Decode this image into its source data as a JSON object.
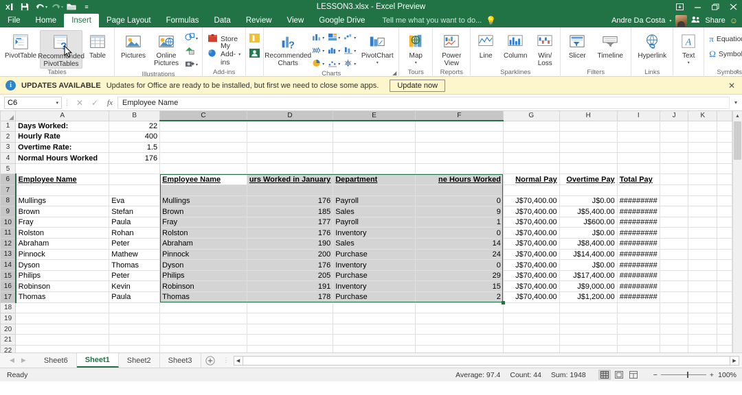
{
  "titlebar": {
    "filename": "LESSON3.xlsx - Excel Preview",
    "qat": [
      {
        "name": "excel-logo-icon",
        "label": "XL"
      },
      {
        "name": "save-icon",
        "label": "Save"
      },
      {
        "name": "undo-icon",
        "label": "Undo"
      },
      {
        "name": "redo-icon",
        "label": "Redo"
      },
      {
        "name": "open-icon",
        "label": "Open"
      },
      {
        "name": "customize-qat-icon",
        "label": "Customize Quick Access Toolbar"
      }
    ],
    "window_controls": [
      {
        "name": "ribbon-display-options-button",
        "glyph": "❐"
      },
      {
        "name": "minimize-button",
        "glyph": "—"
      },
      {
        "name": "restore-button",
        "glyph": "❐"
      },
      {
        "name": "close-button",
        "glyph": "✕"
      }
    ]
  },
  "tabs": {
    "items": [
      {
        "label": "File",
        "active": false
      },
      {
        "label": "Home",
        "active": false
      },
      {
        "label": "Insert",
        "active": true
      },
      {
        "label": "Page Layout",
        "active": false
      },
      {
        "label": "Formulas",
        "active": false
      },
      {
        "label": "Data",
        "active": false
      },
      {
        "label": "Review",
        "active": false
      },
      {
        "label": "View",
        "active": false
      },
      {
        "label": "Google Drive",
        "active": false
      }
    ],
    "tellme_placeholder": "Tell me what you want to do...",
    "user_name": "Andre Da Costa",
    "share_label": "Share"
  },
  "ribbon": {
    "groups": [
      {
        "label": "Tables",
        "buttons": [
          {
            "label1": "PivotTable",
            "label2": "",
            "icon": "pivottable-icon"
          },
          {
            "label1": "Recommended",
            "label2": "PivotTables",
            "icon": "recommended-pivottables-icon",
            "highlighted": true
          },
          {
            "label1": "Table",
            "label2": "",
            "icon": "table-icon"
          }
        ]
      },
      {
        "label": "Illustrations",
        "buttons": [
          {
            "label1": "Pictures",
            "label2": "",
            "icon": "pictures-icon"
          },
          {
            "label1": "Online",
            "label2": "Pictures",
            "icon": "online-pictures-icon"
          }
        ],
        "small_icons": [
          {
            "name": "shapes-icon"
          },
          {
            "name": "smartart-icon"
          },
          {
            "name": "screenshot-icon"
          }
        ]
      },
      {
        "label": "Add-ins",
        "small_buttons": [
          {
            "label": "Store",
            "icon": "store-icon"
          },
          {
            "label": "My Add-ins",
            "icon": "my-addins-icon"
          }
        ],
        "small_icons": [
          {
            "name": "bing-maps-icon"
          },
          {
            "name": "people-graph-icon"
          }
        ]
      },
      {
        "label": "Charts",
        "buttons": [
          {
            "label1": "Recommended",
            "label2": "Charts",
            "icon": "recommended-charts-icon"
          },
          {
            "label1": "PivotChart",
            "label2": "",
            "icon": "pivotchart-icon"
          }
        ],
        "chart_icons": [
          {
            "name": "column-chart-icon"
          },
          {
            "name": "hierarchy-chart-icon"
          },
          {
            "name": "waterfall-chart-icon"
          },
          {
            "name": "scatter-chart-icon"
          },
          {
            "name": "bar-chart-icon"
          },
          {
            "name": "stock-chart-icon"
          },
          {
            "name": "pie-chart-icon"
          },
          {
            "name": "line-chart-icon"
          },
          {
            "name": "radar-chart-icon"
          }
        ],
        "has_dialog_launcher": true
      },
      {
        "label": "Tours",
        "buttons": [
          {
            "label1": "Map",
            "label2": "",
            "icon": "map-icon"
          }
        ]
      },
      {
        "label": "Reports",
        "buttons": [
          {
            "label1": "Power",
            "label2": "View",
            "icon": "power-view-icon"
          }
        ]
      },
      {
        "label": "Sparklines",
        "buttons": [
          {
            "label1": "Line",
            "label2": "",
            "icon": "sparkline-line-icon"
          },
          {
            "label1": "Column",
            "label2": "",
            "icon": "sparkline-column-icon"
          },
          {
            "label1": "Win/",
            "label2": "Loss",
            "icon": "sparkline-winloss-icon"
          }
        ]
      },
      {
        "label": "Filters",
        "buttons": [
          {
            "label1": "Slicer",
            "label2": "",
            "icon": "slicer-icon"
          },
          {
            "label1": "Timeline",
            "label2": "",
            "icon": "timeline-icon"
          }
        ]
      },
      {
        "label": "Links",
        "buttons": [
          {
            "label1": "Hyperlink",
            "label2": "",
            "icon": "hyperlink-icon"
          }
        ]
      },
      {
        "label": "",
        "buttons": [
          {
            "label1": "Text",
            "label2": "",
            "icon": "text-icon"
          }
        ]
      },
      {
        "label": "Symbols",
        "small_buttons": [
          {
            "label": "Equation",
            "icon": "equation-icon"
          },
          {
            "label": "Symbol",
            "icon": "symbol-icon"
          }
        ]
      }
    ]
  },
  "notification": {
    "title": "UPDATES AVAILABLE",
    "message": "Updates for Office are ready to be installed, but first we need to close some apps.",
    "button": "Update now",
    "close": "✕"
  },
  "formula_bar": {
    "name_box": "C6",
    "cancel_icon": "✕",
    "enter_icon": "✓",
    "function_icon": "fx",
    "value": "Employee Name"
  },
  "grid": {
    "columns": [
      "A",
      "B",
      "C",
      "D",
      "E",
      "F",
      "G",
      "H",
      "I",
      "J",
      "K"
    ],
    "selected_columns": [
      "C",
      "D",
      "E",
      "F"
    ],
    "rows": [
      1,
      2,
      3,
      4,
      5,
      6,
      7,
      8,
      9,
      10,
      11,
      12,
      13,
      14,
      15,
      16,
      17,
      18,
      19,
      20,
      21,
      22
    ],
    "selected_rows": [
      6,
      7,
      8,
      9,
      10,
      11,
      12,
      13,
      14,
      15,
      16,
      17
    ],
    "selection_range": "C6:F17",
    "data": [
      {
        "r": 1,
        "A": "Days Worked:",
        "B": "22"
      },
      {
        "r": 2,
        "A": "Hourly Rate",
        "B": "400"
      },
      {
        "r": 3,
        "A": "Overtime Rate:",
        "B": "1.5"
      },
      {
        "r": 4,
        "A": "Normal Hours Worked",
        "B": "176"
      },
      {
        "r": 5
      },
      {
        "r": 6,
        "A": "Employee Name",
        "C": "Employee Name",
        "D": "urs Worked in January",
        "E": "Department",
        "F": "ne Hours Worked",
        "G": "Normal Pay",
        "H": "Overtime Pay",
        "I": "Total Pay"
      },
      {
        "r": 7
      },
      {
        "r": 8,
        "A": "Mullings",
        "B": "Eva",
        "C": "Mullings",
        "D": "176",
        "E": "Payroll",
        "F": "0",
        "G": "J$70,400.00",
        "H": "J$0.00",
        "I": "#########"
      },
      {
        "r": 9,
        "A": "Brown",
        "B": "Stefan",
        "C": "Brown",
        "D": "185",
        "E": "Sales",
        "F": "9",
        "G": "J$70,400.00",
        "H": "J$5,400.00",
        "I": "#########"
      },
      {
        "r": 10,
        "A": "Fray",
        "B": "Paula",
        "C": "Fray",
        "D": "177",
        "E": "Payroll",
        "F": "1",
        "G": "J$70,400.00",
        "H": "J$600.00",
        "I": "#########"
      },
      {
        "r": 11,
        "A": "Rolston",
        "B": "Rohan",
        "C": "Rolston",
        "D": "176",
        "E": "Inventory",
        "F": "0",
        "G": "J$70,400.00",
        "H": "J$0.00",
        "I": "#########"
      },
      {
        "r": 12,
        "A": "Abraham",
        "B": "Peter",
        "C": "Abraham",
        "D": "190",
        "E": "Sales",
        "F": "14",
        "G": "J$70,400.00",
        "H": "J$8,400.00",
        "I": "#########"
      },
      {
        "r": 13,
        "A": "Pinnock",
        "B": "Mathew",
        "C": "Pinnock",
        "D": "200",
        "E": "Purchase",
        "F": "24",
        "G": "J$70,400.00",
        "H": "J$14,400.00",
        "I": "#########"
      },
      {
        "r": 14,
        "A": "Dyson",
        "B": "Thomas",
        "C": "Dyson",
        "D": "176",
        "E": "Inventory",
        "F": "0",
        "G": "J$70,400.00",
        "H": "J$0.00",
        "I": "#########"
      },
      {
        "r": 15,
        "A": "Philips",
        "B": "Peter",
        "C": "Philips",
        "D": "205",
        "E": "Purchase",
        "F": "29",
        "G": "J$70,400.00",
        "H": "J$17,400.00",
        "I": "#########"
      },
      {
        "r": 16,
        "A": "Robinson",
        "B": "Kevin",
        "C": "Robinson",
        "D": "191",
        "E": "Inventory",
        "F": "15",
        "G": "J$70,400.00",
        "H": "J$9,000.00",
        "I": "#########"
      },
      {
        "r": 17,
        "A": "Thomas",
        "B": "Paula",
        "C": "Thomas",
        "D": "178",
        "E": "Purchase",
        "F": "2",
        "G": "J$70,400.00",
        "H": "J$1,200.00",
        "I": "#########"
      },
      {
        "r": 18
      },
      {
        "r": 19
      },
      {
        "r": 20
      },
      {
        "r": 21
      },
      {
        "r": 22
      }
    ]
  },
  "sheet_tabs": {
    "items": [
      {
        "label": "Sheet6",
        "active": false
      },
      {
        "label": "Sheet1",
        "active": true
      },
      {
        "label": "Sheet2",
        "active": false
      },
      {
        "label": "Sheet3",
        "active": false
      }
    ],
    "add_label": "+"
  },
  "status_bar": {
    "mode": "Ready",
    "average": "Average: 97.4",
    "count": "Count: 44",
    "sum": "Sum: 1948",
    "views": [
      {
        "name": "normal-view-button",
        "active": true
      },
      {
        "name": "page-layout-view-button",
        "active": false
      },
      {
        "name": "page-break-preview-button",
        "active": false
      }
    ],
    "zoom_out": "−",
    "zoom_in": "+",
    "zoom_level": "100%"
  },
  "colors": {
    "brand_green": "#217346",
    "notification_bg": "#fdf6cc",
    "selection_gray": "#d4d4d4",
    "header_gray": "#f0f0f0"
  }
}
